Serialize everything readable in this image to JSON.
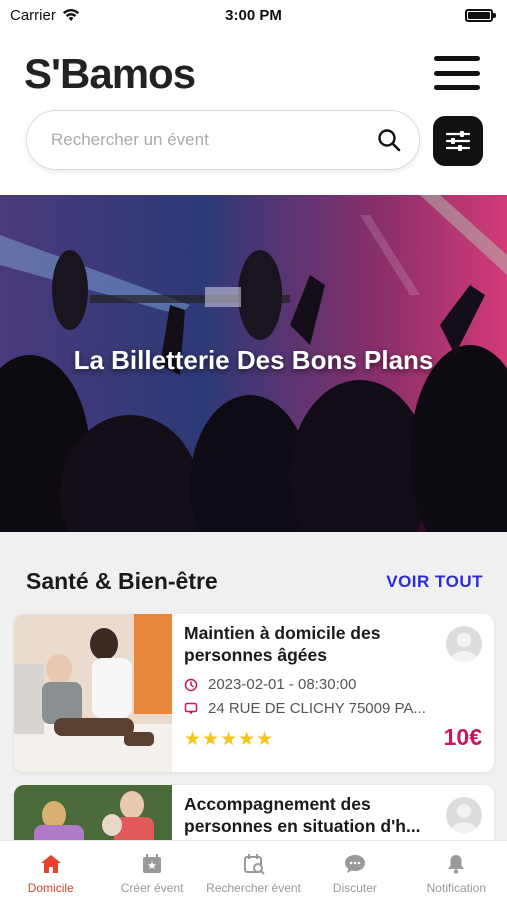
{
  "status_bar": {
    "carrier": "Carrier",
    "time": "3:00 PM",
    "battery_level": 1.0
  },
  "header": {
    "logo_text": "S'Bamos",
    "menu_icon": "hamburger-menu-icon"
  },
  "search": {
    "placeholder": "Rechercher un évent",
    "value": "",
    "icon": "search-icon",
    "filter_icon": "sliders-icon"
  },
  "banner": {
    "title": "La Billetterie Des Bons Plans"
  },
  "section": {
    "title": "Santé & Bien-être",
    "see_all": "VOIR TOUT"
  },
  "events": [
    {
      "title": "Maintien à domicile des personnes âgées",
      "date": "2023-02-01 - 08:30:00",
      "address": "24 RUE DE CLICHY 75009 PA...",
      "rating": 5,
      "stars": "★★★★★",
      "price": "10€"
    },
    {
      "title": "Accompagnement des personnes en situation d'h..."
    }
  ],
  "tabs": [
    {
      "label": "Domicile",
      "icon": "home-icon",
      "active": true
    },
    {
      "label": "Créer évent",
      "icon": "calendar-star-icon",
      "active": false
    },
    {
      "label": "Rechercher évent",
      "icon": "calendar-search-icon",
      "active": false
    },
    {
      "label": "Discuter",
      "icon": "chat-bubble-icon",
      "active": false
    },
    {
      "label": "Notification",
      "icon": "bell-icon",
      "active": false
    }
  ],
  "colors": {
    "accent": "#e8412d",
    "link": "#2b2bd9",
    "price": "#c8175d",
    "star": "#f5c518"
  }
}
